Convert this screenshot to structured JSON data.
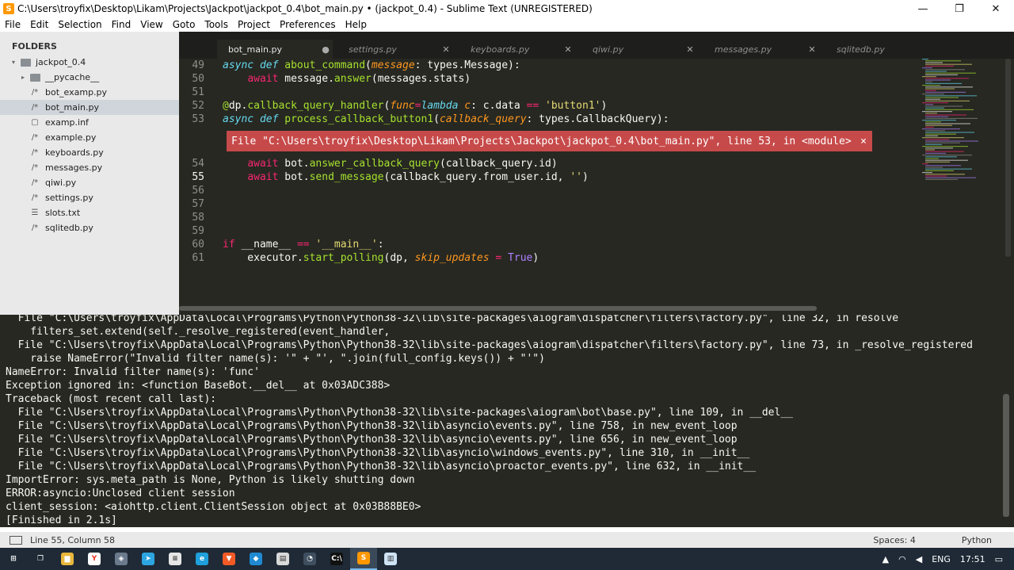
{
  "window": {
    "title": "C:\\Users\\troyfix\\Desktop\\Likam\\Projects\\Jackpot\\jackpot_0.4\\bot_main.py • (jackpot_0.4) - Sublime Text (UNREGISTERED)",
    "minimize": "—",
    "maximize": "❐",
    "close": "✕"
  },
  "menu": [
    "File",
    "Edit",
    "Selection",
    "Find",
    "View",
    "Goto",
    "Tools",
    "Project",
    "Preferences",
    "Help"
  ],
  "sidebar": {
    "header": "FOLDERS",
    "items": [
      {
        "label": "jackpot_0.4",
        "icon": "folder-open-icon",
        "glyph": "▾",
        "indent": 0
      },
      {
        "label": "__pycache__",
        "icon": "folder-icon",
        "glyph": "▸",
        "indent": 1
      },
      {
        "label": "bot_examp.py",
        "icon": "code-file-icon",
        "glyph": "/*",
        "indent": 1
      },
      {
        "label": "bot_main.py",
        "icon": "code-file-icon",
        "glyph": "/*",
        "indent": 1,
        "active": true
      },
      {
        "label": "examp.inf",
        "icon": "file-icon",
        "glyph": "▢",
        "indent": 1
      },
      {
        "label": "example.py",
        "icon": "code-file-icon",
        "glyph": "/*",
        "indent": 1
      },
      {
        "label": "keyboards.py",
        "icon": "code-file-icon",
        "glyph": "/*",
        "indent": 1
      },
      {
        "label": "messages.py",
        "icon": "code-file-icon",
        "glyph": "/*",
        "indent": 1
      },
      {
        "label": "qiwi.py",
        "icon": "code-file-icon",
        "glyph": "/*",
        "indent": 1
      },
      {
        "label": "settings.py",
        "icon": "code-file-icon",
        "glyph": "/*",
        "indent": 1
      },
      {
        "label": "slots.txt",
        "icon": "text-file-icon",
        "glyph": "☰",
        "indent": 1
      },
      {
        "label": "sqlitedb.py",
        "icon": "code-file-icon",
        "glyph": "/*",
        "indent": 1
      }
    ]
  },
  "tabs": [
    {
      "label": "bot_main.py",
      "close": "●",
      "active": true
    },
    {
      "label": "settings.py",
      "close": "✕"
    },
    {
      "label": "keyboards.py",
      "close": "✕"
    },
    {
      "label": "qiwi.py",
      "close": "✕"
    },
    {
      "label": "messages.py",
      "close": "✕"
    },
    {
      "label": "sqlitedb.py",
      "close": ""
    }
  ],
  "editor": {
    "lines": [
      {
        "n": "49",
        "html": "<span class='k'>async</span> <span class='k'>def</span> <span class='fn'>about_command</span>(<span class='p'>message</span>: types.Message):"
      },
      {
        "n": "50",
        "html": "    <span class='kw'>await</span> message.<span class='fn'>answer</span>(messages.stats)"
      },
      {
        "n": "51",
        "html": ""
      },
      {
        "n": "52",
        "html": "<span class='fn'>@</span>dp.<span class='fn'>callback_query_handler</span>(<span class='p'>func</span><span class='kw'>=</span><span class='k'>lambda</span> <span class='p'>c</span>: c.data <span class='kw'>==</span> <span class='s'>'button1'</span>)"
      },
      {
        "n": "53",
        "html": "<span class='k'>async</span> <span class='k'>def</span> <span class='fn'>process_callback_button1</span>(<span class='p'>callback_query</span>: types.CallbackQuery):"
      },
      {
        "n": "54",
        "html": "    <span class='kw'>await</span> bot.<span class='fn'>answer_callback_query</span>(callback_query.id)"
      },
      {
        "n": "55",
        "html": "    <span class='kw'>await</span> bot.<span class='fn'>send_message</span>(callback_query.from_user.id, <span class='s'>''</span>)"
      },
      {
        "n": "56",
        "html": ""
      },
      {
        "n": "57",
        "html": ""
      },
      {
        "n": "58",
        "html": ""
      },
      {
        "n": "59",
        "html": ""
      },
      {
        "n": "60",
        "html": "<span class='kw'>if</span> __name__ <span class='kw'>==</span> <span class='s'>'__main__'</span>:"
      },
      {
        "n": "61",
        "html": "    executor.<span class='fn'>start_polling</span>(dp, <span class='p'>skip_updates</span> <span class='kw'>=</span> <span class='c'>True</span>)"
      }
    ],
    "error": "File \"C:\\Users\\troyfix\\Desktop\\Likam\\Projects\\Jackpot\\jackpot_0.4\\bot_main.py\", line 53, in <module>",
    "error_close": "×"
  },
  "console": [
    "  File \"C:\\Users\\troyfix\\AppData\\Local\\Programs\\Python\\Python38-32\\lib\\site-packages\\aiogram\\dispatcher\\filters\\factory.py\", line 32, in resolve",
    "    filters_set.extend(self._resolve_registered(event_handler,",
    "  File \"C:\\Users\\troyfix\\AppData\\Local\\Programs\\Python\\Python38-32\\lib\\site-packages\\aiogram\\dispatcher\\filters\\factory.py\", line 73, in _resolve_registered",
    "    raise NameError(\"Invalid filter name(s): '\" + \"', \".join(full_config.keys()) + \"'\")",
    "NameError: Invalid filter name(s): 'func'",
    "Exception ignored in: <function BaseBot.__del__ at 0x03ADC388>",
    "Traceback (most recent call last):",
    "  File \"C:\\Users\\troyfix\\AppData\\Local\\Programs\\Python\\Python38-32\\lib\\site-packages\\aiogram\\bot\\base.py\", line 109, in __del__",
    "  File \"C:\\Users\\troyfix\\AppData\\Local\\Programs\\Python\\Python38-32\\lib\\asyncio\\events.py\", line 758, in new_event_loop",
    "  File \"C:\\Users\\troyfix\\AppData\\Local\\Programs\\Python\\Python38-32\\lib\\asyncio\\events.py\", line 656, in new_event_loop",
    "  File \"C:\\Users\\troyfix\\AppData\\Local\\Programs\\Python\\Python38-32\\lib\\asyncio\\windows_events.py\", line 310, in __init__",
    "  File \"C:\\Users\\troyfix\\AppData\\Local\\Programs\\Python\\Python38-32\\lib\\asyncio\\proactor_events.py\", line 632, in __init__",
    "ImportError: sys.meta_path is None, Python is likely shutting down",
    "ERROR:asyncio:Unclosed client session",
    "client_session: <aiohttp.client.ClientSession object at 0x03B88BE0>",
    "[Finished in 2.1s]"
  ],
  "status": {
    "position": "Line 55, Column 58",
    "spaces": "Spaces: 4",
    "syntax": "Python"
  },
  "taskbar": {
    "apps": [
      {
        "name": "windows-start-icon",
        "glyph": "⊞",
        "bg": "transparent"
      },
      {
        "name": "task-view-icon",
        "glyph": "❐",
        "bg": "transparent"
      },
      {
        "name": "file-explorer-icon",
        "glyph": "▆",
        "bg": "#e8b73c"
      },
      {
        "name": "yandex-browser-icon",
        "glyph": "Y",
        "bg": "#ffffff"
      },
      {
        "name": "app-icon",
        "glyph": "◈",
        "bg": "#6b7a8c"
      },
      {
        "name": "telegram-icon",
        "glyph": "➤",
        "bg": "#2ca5e0"
      },
      {
        "name": "text-editor-icon",
        "glyph": "≡",
        "bg": "#e6e6e6"
      },
      {
        "name": "edge-icon",
        "glyph": "e",
        "bg": "#1fa0dc"
      },
      {
        "name": "brave-icon",
        "glyph": "▼",
        "bg": "#f25a26"
      },
      {
        "name": "vscode-icon",
        "glyph": "◆",
        "bg": "#1f8ad2"
      },
      {
        "name": "notepad-icon",
        "glyph": "▤",
        "bg": "#d9d9d9"
      },
      {
        "name": "speedometer-icon",
        "glyph": "◔",
        "bg": "#3f4f60"
      },
      {
        "name": "cmd-icon",
        "glyph": "C:\\",
        "bg": "#111111"
      },
      {
        "name": "sublime-text-icon",
        "glyph": "S",
        "bg": "#ff9800",
        "active": true
      },
      {
        "name": "notes-icon",
        "glyph": "▥",
        "bg": "#cfe3f5"
      }
    ],
    "language": "ENG",
    "time": "17:51"
  }
}
